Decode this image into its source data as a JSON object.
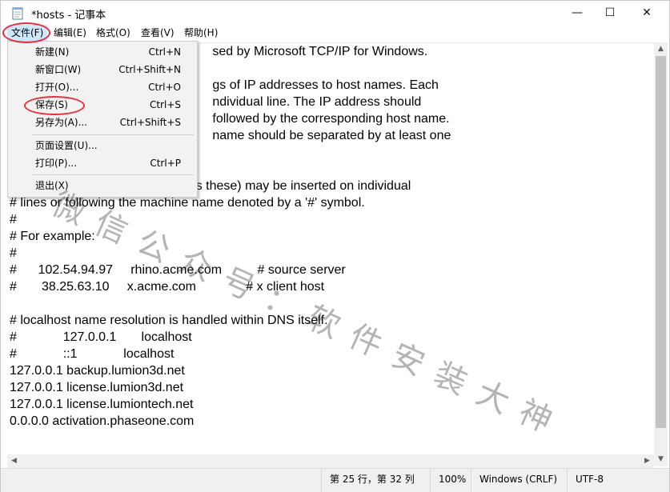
{
  "window": {
    "title": "*hosts - 记事本",
    "controls": {
      "minimize": "—",
      "maximize": "☐",
      "close": "✕"
    }
  },
  "menubar": {
    "items": [
      {
        "label": "文件(F)",
        "active": true
      },
      {
        "label": "编辑(E)"
      },
      {
        "label": "格式(O)"
      },
      {
        "label": "查看(V)"
      },
      {
        "label": "帮助(H)"
      }
    ]
  },
  "file_menu": {
    "items": [
      {
        "label": "新建(N)",
        "shortcut": "Ctrl+N"
      },
      {
        "label": "新窗口(W)",
        "shortcut": "Ctrl+Shift+N"
      },
      {
        "label": "打开(O)...",
        "shortcut": "Ctrl+O"
      },
      {
        "label": "保存(S)",
        "shortcut": "Ctrl+S"
      },
      {
        "label": "另存为(A)...",
        "shortcut": "Ctrl+Shift+S"
      },
      {
        "label": "页面设置(U)...",
        "shortcut": ""
      },
      {
        "label": "打印(P)...",
        "shortcut": "Ctrl+P"
      },
      {
        "label": "退出(X)",
        "shortcut": ""
      }
    ]
  },
  "editor": {
    "lines": [
      "                                                         sed by Microsoft TCP/IP for Windows.",
      "",
      "                                                         gs of IP addresses to host names. Each",
      "                                                         ndividual line. The IP address should",
      "                                                         followed by the corresponding host name.",
      "                                                         name should be separated by at least one",
      "",
      "",
      "# Additionally, comments (such as these) may be inserted on individual",
      "# lines or following the machine name denoted by a '#' symbol.",
      "#",
      "# For example:",
      "#",
      "#      102.54.94.97     rhino.acme.com          # source server",
      "#       38.25.63.10     x.acme.com              # x client host",
      "",
      "# localhost name resolution is handled within DNS itself.",
      "#             127.0.0.1       localhost",
      "#             ::1             localhost",
      "127.0.0.1 backup.lumion3d.net",
      "127.0.0.1 license.lumion3d.net",
      "127.0.0.1 license.lumiontech.net",
      "0.0.0.0 activation.phaseone.com"
    ]
  },
  "statusbar": {
    "position": "第 25 行，第 32 列",
    "zoom": "100%",
    "line_ending": "Windows (CRLF)",
    "encoding": "UTF-8"
  },
  "watermark": "微信公众号：软件安装大神",
  "colors": {
    "menu_highlight": "#cce8ff",
    "annotation": "#e8303a"
  }
}
